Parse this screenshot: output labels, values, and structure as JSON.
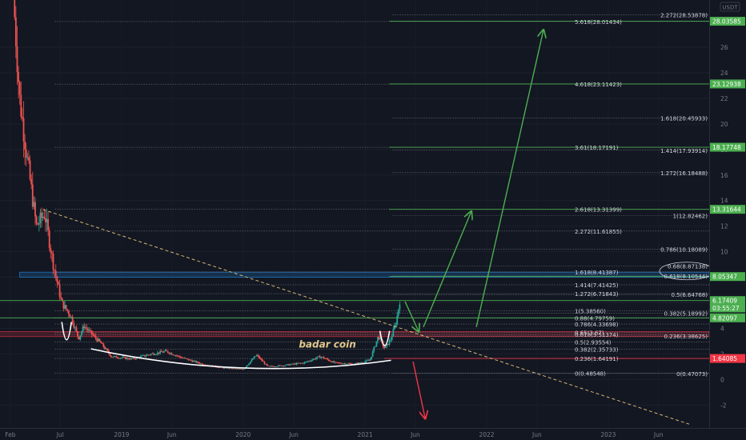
{
  "chart_data": {
    "type": "candlestick",
    "currency": "USDT",
    "y_axis": {
      "ticks": [
        -2,
        0,
        2,
        4,
        6,
        8,
        10,
        12,
        14,
        16,
        18,
        20,
        22,
        24,
        26
      ],
      "range": [
        -3.8,
        29.7
      ]
    },
    "x_axis": {
      "ticks": [
        "Feb",
        "Jul",
        "2019",
        "Jun",
        "2020",
        "Jun",
        "2021",
        "Jun",
        "2022",
        "Jun",
        "2023",
        "Jun"
      ],
      "range": [
        "2018-01-01",
        "2023-10-31"
      ]
    },
    "price_series_approx": [
      {
        "date": "2018-02-10",
        "close": 30
      },
      {
        "date": "2018-03-01",
        "close": 22
      },
      {
        "date": "2018-03-25",
        "close": 17
      },
      {
        "date": "2018-04-20",
        "close": 12
      },
      {
        "date": "2018-05-15",
        "close": 13
      },
      {
        "date": "2018-06-10",
        "close": 9
      },
      {
        "date": "2018-07-05",
        "close": 6
      },
      {
        "date": "2018-08-01",
        "close": 5
      },
      {
        "date": "2018-08-25",
        "close": 3.2
      },
      {
        "date": "2018-09-10",
        "close": 4.2
      },
      {
        "date": "2018-10-05",
        "close": 3.5
      },
      {
        "date": "2018-11-01",
        "close": 2.8
      },
      {
        "date": "2018-12-01",
        "close": 1.8
      },
      {
        "date": "2019-02-01",
        "close": 1.6
      },
      {
        "date": "2019-04-01",
        "close": 2.0
      },
      {
        "date": "2019-05-15",
        "close": 2.2
      },
      {
        "date": "2019-07-01",
        "close": 1.7
      },
      {
        "date": "2019-09-01",
        "close": 1.2
      },
      {
        "date": "2019-11-01",
        "close": 0.9
      },
      {
        "date": "2020-01-01",
        "close": 0.8
      },
      {
        "date": "2020-02-10",
        "close": 1.9
      },
      {
        "date": "2020-03-15",
        "close": 1.0
      },
      {
        "date": "2020-05-01",
        "close": 1.1
      },
      {
        "date": "2020-07-01",
        "close": 1.3
      },
      {
        "date": "2020-08-20",
        "close": 1.8
      },
      {
        "date": "2020-10-01",
        "close": 1.3
      },
      {
        "date": "2020-12-01",
        "close": 1.2
      },
      {
        "date": "2021-01-15",
        "close": 1.5
      },
      {
        "date": "2021-02-10",
        "close": 3.4
      },
      {
        "date": "2021-03-01",
        "close": 2.4
      },
      {
        "date": "2021-03-20",
        "close": 3.2
      },
      {
        "date": "2021-04-05",
        "close": 4.6
      },
      {
        "date": "2021-04-15",
        "close": 6.17
      }
    ],
    "price_labels": [
      {
        "text": "28.03585",
        "value": 28.03585,
        "color": "#4caf50"
      },
      {
        "text": "23.12938",
        "value": 23.12938,
        "color": "#4caf50"
      },
      {
        "text": "18.17748",
        "value": 18.17748,
        "color": "#4caf50"
      },
      {
        "text": "13.31644",
        "value": 13.31644,
        "color": "#4caf50"
      },
      {
        "text": "8.05347",
        "value": 8.05347,
        "color": "#4caf50"
      },
      {
        "text": "6.17409",
        "value": 6.17409,
        "color": "#4caf50"
      },
      {
        "text": "03:55:27",
        "value": 5.6,
        "color": "#4caf50"
      },
      {
        "text": "4.82097",
        "value": 4.82097,
        "color": "#4caf50"
      },
      {
        "text": "1.64085",
        "value": 1.64085,
        "color": "#f23645"
      }
    ],
    "fib_set_a": [
      {
        "text": "0(0.48548)",
        "value": 0.48548
      },
      {
        "text": "0.236(1.64191)",
        "value": 1.64191
      },
      {
        "text": "0.382(2.35733)",
        "value": 2.35733
      },
      {
        "text": "0.5(2.93554)",
        "value": 2.93554
      },
      {
        "text": "0.618(3.51374)",
        "value": 3.51374
      },
      {
        "text": "0.65(3.67)",
        "value": 3.67
      },
      {
        "text": "0.786(4.33698)",
        "value": 4.33698
      },
      {
        "text": "0.88(4.79759)",
        "value": 4.79759
      },
      {
        "text": "1(5.38560)",
        "value": 5.3856
      },
      {
        "text": "1.272(6.71843)",
        "value": 6.71843
      },
      {
        "text": "1.414(7.41425)",
        "value": 7.41425
      },
      {
        "text": "1.618(8.41387)",
        "value": 8.41387
      },
      {
        "text": "2.272(11.61855)",
        "value": 11.61855
      },
      {
        "text": "2.618(13.31399)",
        "value": 13.31399
      },
      {
        "text": "3.61(18.17191)",
        "value": 18.17191
      },
      {
        "text": "4.618(23.11423)",
        "value": 23.11423
      },
      {
        "text": "5.618(28.01434)",
        "value": 28.01434
      }
    ],
    "fib_set_b": [
      {
        "text": "0(0.47073)",
        "value": 0.47073
      },
      {
        "text": "0.236(3.38625)",
        "value": 3.38625
      },
      {
        "text": "0.382(5.18992)",
        "value": 5.18992
      },
      {
        "text": "0.5(6.64768)",
        "value": 6.64768
      },
      {
        "text": "0.618(8.10544)",
        "value": 8.10544
      },
      {
        "text": "0.68(8.87138)",
        "value": 8.87138
      },
      {
        "text": "0.786(10.18089)",
        "value": 10.18089
      },
      {
        "text": "1(12.82462)",
        "value": 12.82462
      },
      {
        "text": "1.272(16.18488)",
        "value": 16.18488
      },
      {
        "text": "1.414(17.93914)",
        "value": 17.93914
      },
      {
        "text": "1.618(20.45933)",
        "value": 20.45933
      },
      {
        "text": "2.272(28.53878)",
        "value": 28.53878
      }
    ],
    "zones": [
      {
        "name": "blue-zone",
        "from": 8.0,
        "to": 8.4,
        "x_from": "2018-03-01",
        "color": "#2196f3"
      },
      {
        "name": "red-zone",
        "from": 3.35,
        "to": 3.75,
        "x_from": "2017-12-20",
        "color": "#f23645"
      }
    ],
    "trendline": {
      "from": {
        "date": "2018-05-10",
        "value": 13.3
      },
      "to": {
        "date": "2023-09-01",
        "value": -3.5
      },
      "color": "#d1b876"
    },
    "cup_curve": {
      "from": {
        "date": "2018-10-01",
        "value": 2.4
      },
      "low": {
        "date": "2020-01-01",
        "value": 0.9
      },
      "to": {
        "date": "2021-03-20",
        "value": 1.5
      }
    },
    "handles": [
      {
        "date": "2018-07-20",
        "value_top": 4.5,
        "value_bottom": 2.2
      },
      {
        "date": "2021-03-01",
        "value_top": 3.8,
        "value_bottom": 2.0
      }
    ],
    "annotation": {
      "text": "badar coin",
      "date": "2020-09-10",
      "value": 2.5
    },
    "projection_arrows": [
      {
        "color": "#4caf50",
        "points": [
          {
            "date": "2021-05-01",
            "value": 6.1
          },
          {
            "date": "2021-06-10",
            "value": 3.8
          }
        ]
      },
      {
        "color": "#4caf50",
        "points": [
          {
            "date": "2021-06-25",
            "value": 4.1
          },
          {
            "date": "2021-11-15",
            "value": 13.1
          }
        ]
      },
      {
        "color": "#4caf50",
        "points": [
          {
            "date": "2021-12-01",
            "value": 4.1
          },
          {
            "date": "2022-06-20",
            "value": 27.3
          }
        ]
      },
      {
        "color": "#f23645",
        "points": [
          {
            "date": "2021-05-25",
            "value": 1.4
          },
          {
            "date": "2021-06-30",
            "value": -3.0
          }
        ]
      }
    ],
    "colors": {
      "up": "#26a69a",
      "down": "#ef5350",
      "background": "#131722"
    }
  }
}
